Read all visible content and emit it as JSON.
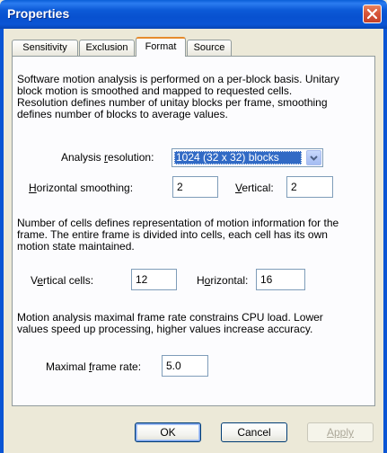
{
  "window": {
    "title": "Properties"
  },
  "tabs": [
    {
      "label": "Sensitivity",
      "active": false
    },
    {
      "label": "Exclusion",
      "active": false
    },
    {
      "label": "Format",
      "active": true
    },
    {
      "label": "Source",
      "active": false
    }
  ],
  "format": {
    "intro": "Software motion analysis is performed on a per-block basis. Unitary block motion is smoothed and mapped to requested cells. Resolution defines number of unitay blocks per frame, smoothing defines number of blocks to average values.",
    "analysis_resolution": {
      "label_pre": "Analysis ",
      "label_hot": "r",
      "label_post": "esolution:",
      "value": "1024 (32 x 32) blocks"
    },
    "horizontal_smoothing": {
      "label_hot": "H",
      "label_post": "orizontal smoothing:",
      "value": "2"
    },
    "vertical_smoothing": {
      "label_hot": "V",
      "label_post": "ertical:",
      "value": "2"
    },
    "cells_text": "Number of cells defines representation of motion information for the frame. The entire frame is divided into cells, each cell has its own motion state maintained.",
    "vertical_cells": {
      "label_pre": "V",
      "label_hot": "e",
      "label_post": "rtical cells:",
      "value": "12"
    },
    "horizontal_cells": {
      "label_pre": "H",
      "label_hot": "o",
      "label_post": "rizontal:",
      "value": "16"
    },
    "framerate_text": "Motion analysis maximal frame rate constrains CPU load. Lower values speed up processing, higher values increase accuracy.",
    "max_frame_rate": {
      "label_pre": "Maximal ",
      "label_hot": "f",
      "label_post": "rame rate:",
      "value": "5.0"
    }
  },
  "buttons": {
    "ok": "OK",
    "cancel": "Cancel",
    "apply": "Apply"
  },
  "colors": {
    "titlebar": "#0a55d4",
    "selection": "#316ac5",
    "active_tab_accent": "#e68b2c"
  }
}
